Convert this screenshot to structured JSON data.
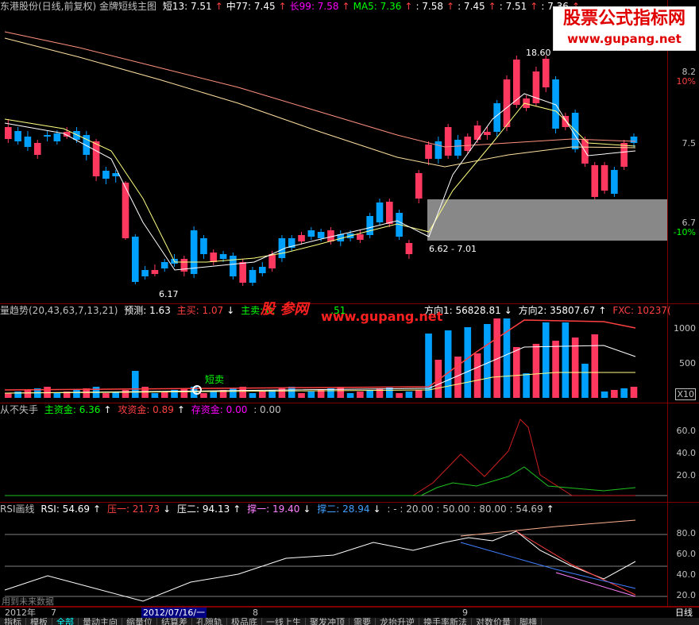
{
  "main": {
    "title": "东港股份(日线,前复权) 金牌短线主图",
    "indicators": [
      {
        "label": "短13: 7.51",
        "arrow": "↑",
        "color": "#ffffff"
      },
      {
        "label": "中77: 7.45",
        "arrow": "↑",
        "color": "#ffffff"
      },
      {
        "label": "长99: 7.58",
        "arrow": "↑",
        "color": "#ff00ff"
      },
      {
        "label": "MA5: 7.36",
        "arrow": "↑",
        "color": "#00ff00"
      },
      {
        "label": ": 7.58",
        "arrow": "↑",
        "color": "#ffffff"
      },
      {
        "label": ": 7.45",
        "arrow": "↑",
        "color": "#ffffff"
      },
      {
        "label": ": 7.51",
        "arrow": "↑",
        "color": "#ffffff"
      },
      {
        "label": ": 7.36",
        "arrow": "↑",
        "color": "#ffffff"
      }
    ],
    "ticks": [
      "8.2",
      "10%",
      "7.5",
      "6.7",
      "-10%"
    ],
    "annotations": {
      "high": "18.60",
      "low": "6.17",
      "range": "6.62 - 7.01"
    }
  },
  "watermark": {
    "line1": "股票公式指标网",
    "line2": "www.gupang.net"
  },
  "volume": {
    "title": "量趋势(20,43,63,7,13,21)",
    "predict": "预测: 1.63",
    "buy": "主买: 1.07",
    "sell": "主卖: 0.",
    "sell_tail": ".51",
    "dir1": "方向1: 56828.81",
    "dir2": "方向2: 35807.67",
    "fxc": "FXC: 10237(",
    "short_sell": "短卖",
    "overlay1": "股 参网",
    "overlay2": "www.gupang.net",
    "ticks": [
      "1000",
      "500",
      "X10"
    ]
  },
  "funds": {
    "title": "从不失手",
    "main_fund": "主资金: 6.36",
    "attack_fund": "攻资金: 0.89",
    "store_fund": "存资金: 0.00",
    "extra": ": 0.00",
    "ticks": [
      "60.0",
      "40.0",
      "20.0"
    ]
  },
  "rsi": {
    "title": "RSI画线",
    "rsi": "RSI: 54.69",
    "press1": "压一: 21.73",
    "press2": "压二: 94.13",
    "support1": "撑一: 19.40",
    "support2": "撑二: 28.94",
    "levels": ": - : 20.00 : 50.00 : 80.00 : 54.69",
    "ticks": [
      "80.0",
      "60.0",
      "40.0",
      "20.0"
    ],
    "footer": "用到未来数据"
  },
  "timebar": {
    "year": "2012年",
    "m7": "7",
    "date": "2012/07/16/一",
    "m8": "8",
    "m9": "9",
    "period": "日线"
  },
  "tabs": [
    "指标",
    "模板",
    "全部",
    "量动主向",
    "缩量位",
    "结算差",
    "孔隙轨",
    "极品底",
    "一线上生",
    "聚发冲顶",
    "需要",
    "龙抬升逆",
    "换手率新法",
    "对数价量",
    "脚横"
  ],
  "colors": {
    "up": "#ff3860",
    "down": "#00a0ff",
    "bg": "#000000",
    "grid": "#800000"
  }
}
